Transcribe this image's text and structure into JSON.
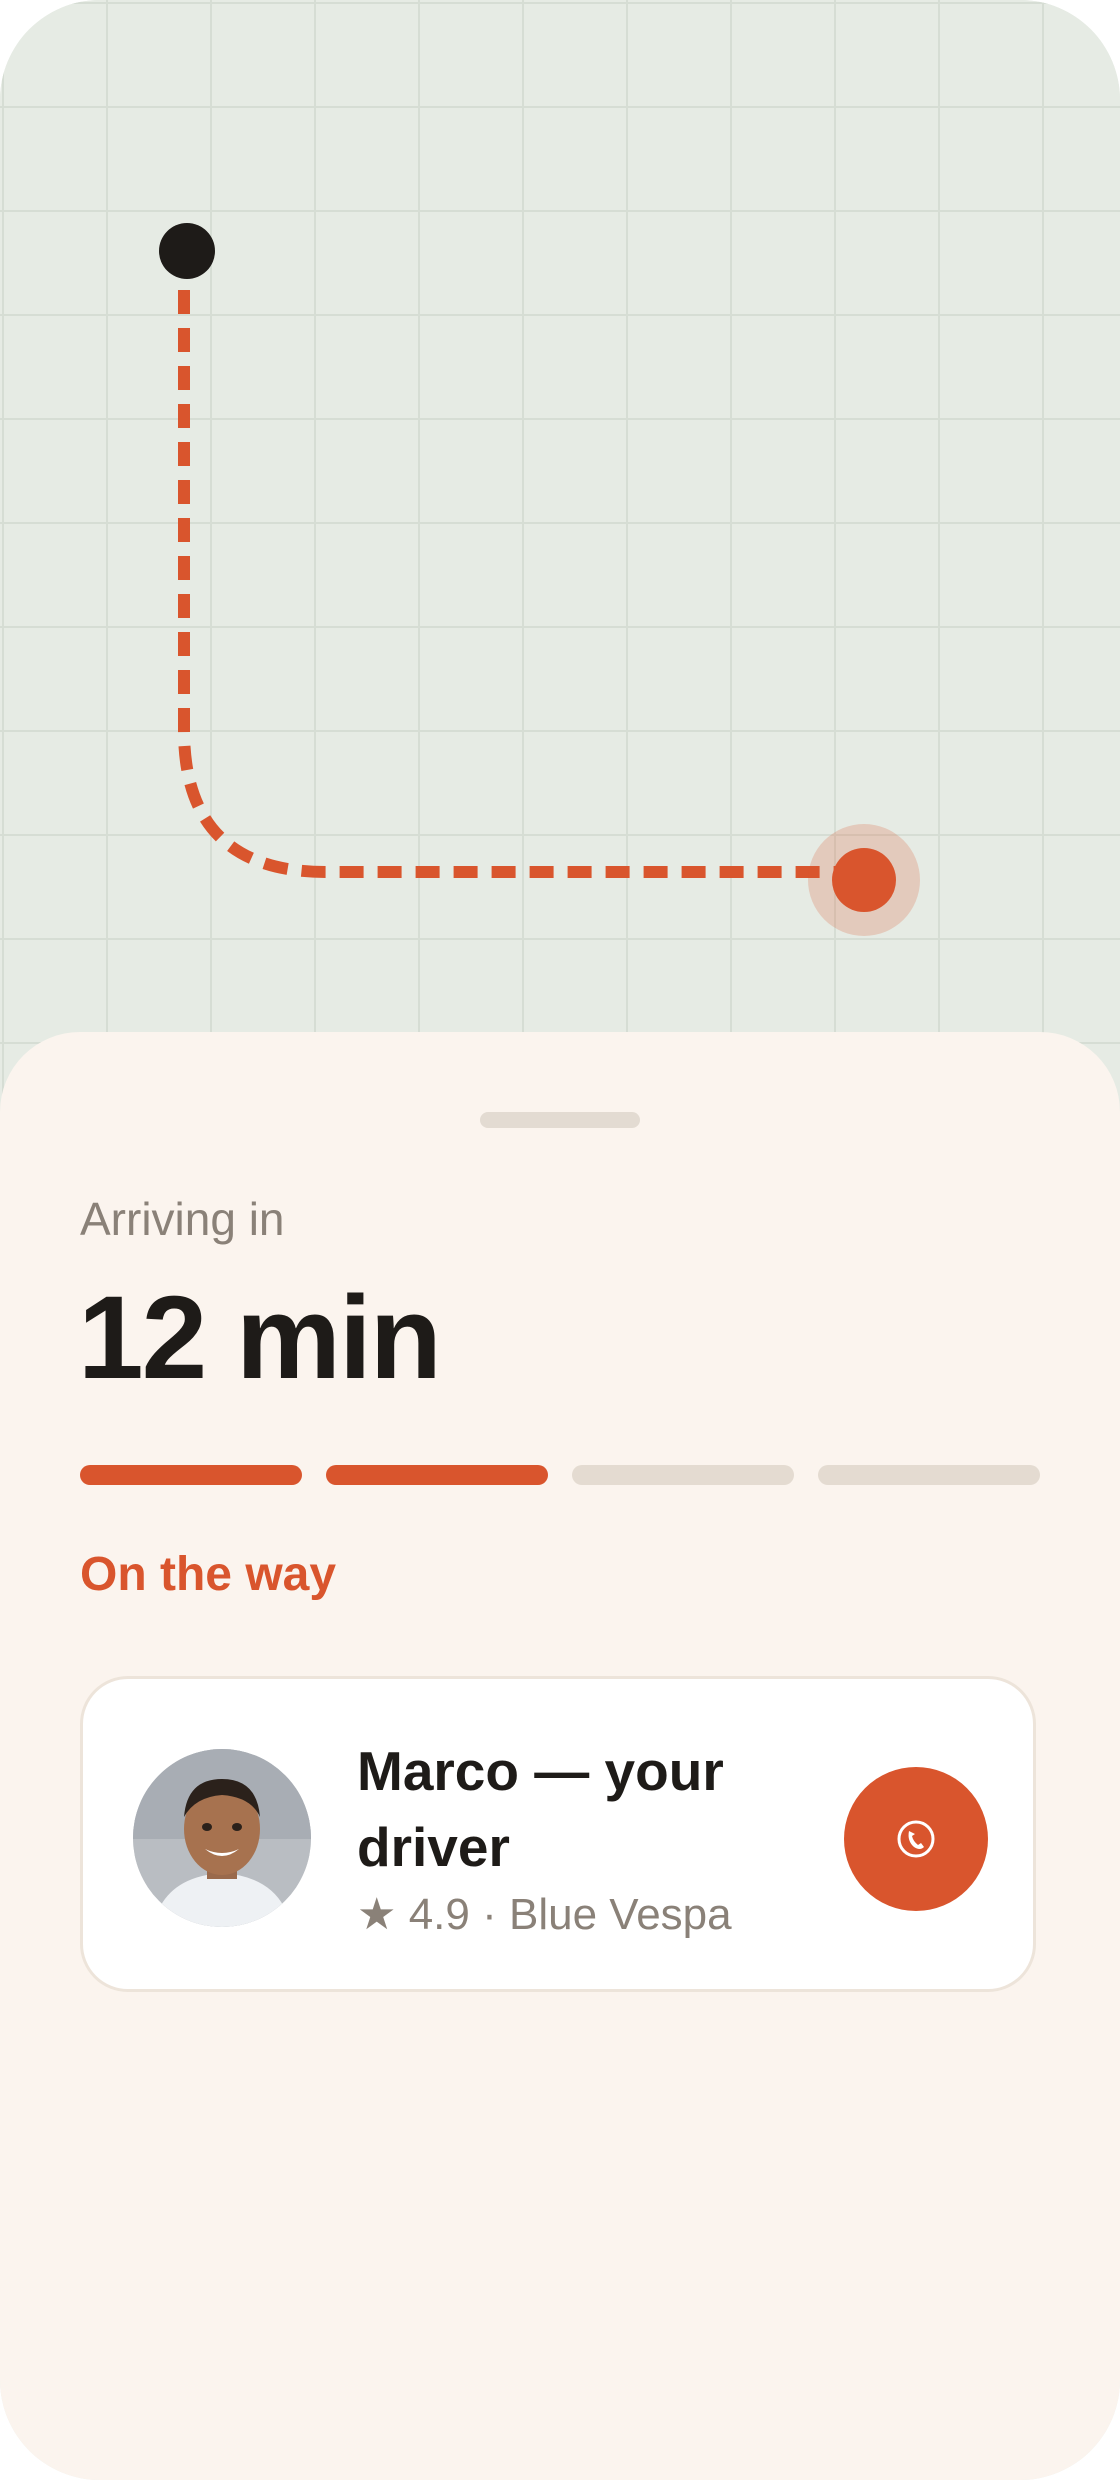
{
  "map": {
    "origin_marker": "origin-dot",
    "destination_marker": "driver-location-dot",
    "route_color": "#d9552d"
  },
  "trip": {
    "arriving_label": "Arriving in",
    "eta": "12 min",
    "progress_steps_total": 4,
    "progress_steps_completed": 2,
    "status": "On the way"
  },
  "driver": {
    "name": "Marco — your driver",
    "rating_icon": "star-icon",
    "rating_star": "★",
    "rating": "4.9",
    "separator": "·",
    "vehicle": "Blue Vespa",
    "call_icon": "phone-icon"
  },
  "colors": {
    "accent": "#d9552d",
    "sheet_background": "#fbf4ee",
    "map_background": "#e6ebe4",
    "text_primary": "#1e1b18",
    "text_secondary": "#8a8178"
  }
}
